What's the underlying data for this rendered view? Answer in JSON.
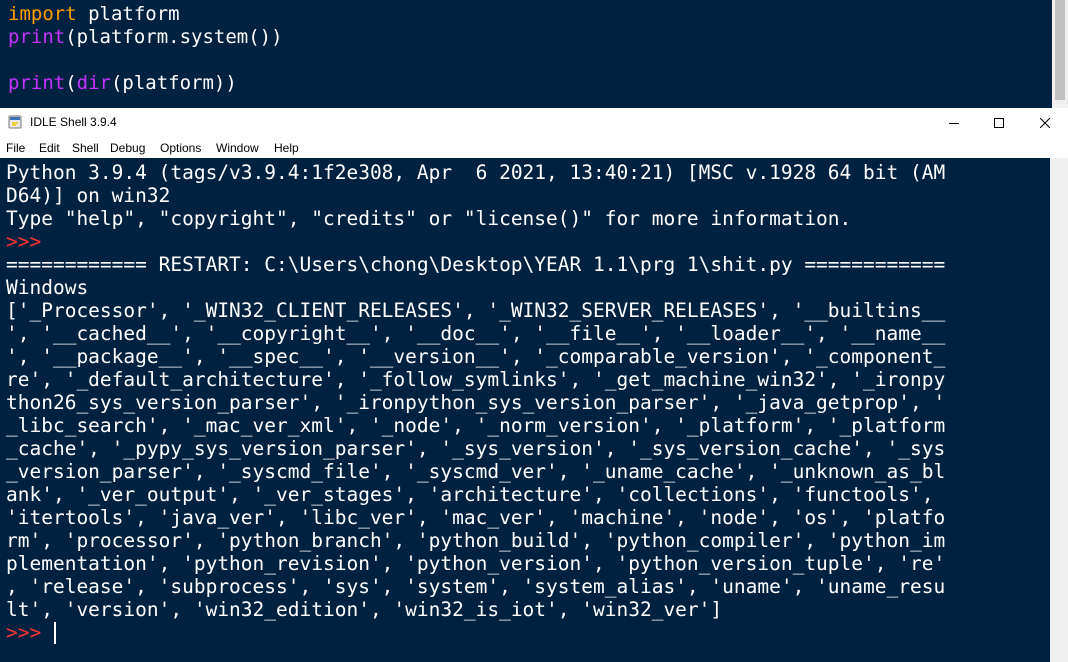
{
  "editor": {
    "line1": {
      "kw": "import",
      "rest": " platform"
    },
    "line2": {
      "bi": "print",
      "rest": "(platform.system())"
    },
    "line3": "",
    "line4": {
      "bi1": "print",
      "mid": "(",
      "bi2": "dir",
      "rest": "(platform))"
    }
  },
  "window": {
    "title": "IDLE Shell 3.9.4",
    "icon": "python-idle-icon",
    "controls": {
      "minimize": "minimize-icon",
      "maximize": "maximize-icon",
      "close": "close-icon"
    }
  },
  "menu": [
    "File",
    "Edit",
    "Shell",
    "Debug",
    "Options",
    "Window",
    "Help"
  ],
  "shell": {
    "banner1": "Python 3.9.4 (tags/v3.9.4:1f2e308, Apr  6 2021, 13:40:21) [MSC v.1928 64 bit (AM",
    "banner2": "D64)] on win32",
    "banner3": "Type \"help\", \"copyright\", \"credits\" or \"license()\" for more information.",
    "prompt": ">>>",
    "restart": "============ RESTART: C:\\Users\\chong\\Desktop\\YEAR 1.1\\prg 1\\shit.py ============",
    "output_lines": [
      "Windows",
      "['_Processor', '_WIN32_CLIENT_RELEASES', '_WIN32_SERVER_RELEASES', '__builtins__",
      "', '__cached__', '__copyright__', '__doc__', '__file__', '__loader__', '__name__",
      "', '__package__', '__spec__', '__version__', '_comparable_version', '_component_",
      "re', '_default_architecture', '_follow_symlinks', '_get_machine_win32', '_ironpy",
      "thon26_sys_version_parser', '_ironpython_sys_version_parser', '_java_getprop', '",
      "_libc_search', '_mac_ver_xml', '_node', '_norm_version', '_platform', '_platform",
      "_cache', '_pypy_sys_version_parser', '_sys_version', '_sys_version_cache', '_sys",
      "_version_parser', '_syscmd_file', '_syscmd_ver', '_uname_cache', '_unknown_as_bl",
      "ank', '_ver_output', '_ver_stages', 'architecture', 'collections', 'functools',",
      "'itertools', 'java_ver', 'libc_ver', 'mac_ver', 'machine', 'node', 'os', 'platfo",
      "rm', 'processor', 'python_branch', 'python_build', 'python_compiler', 'python_im",
      "plementation', 'python_revision', 'python_version', 'python_version_tuple', 're'",
      ", 'release', 'subprocess', 'sys', 'system', 'system_alias', 'uname', 'uname_resu",
      "lt', 'version', 'win32_edition', 'win32_is_iot', 'win32_ver']"
    ]
  },
  "colors": {
    "background": "#002240",
    "keyword": "#ff9d00",
    "builtin": "#c832ff",
    "prompt": "#ff3333",
    "text": "#ffffff"
  }
}
